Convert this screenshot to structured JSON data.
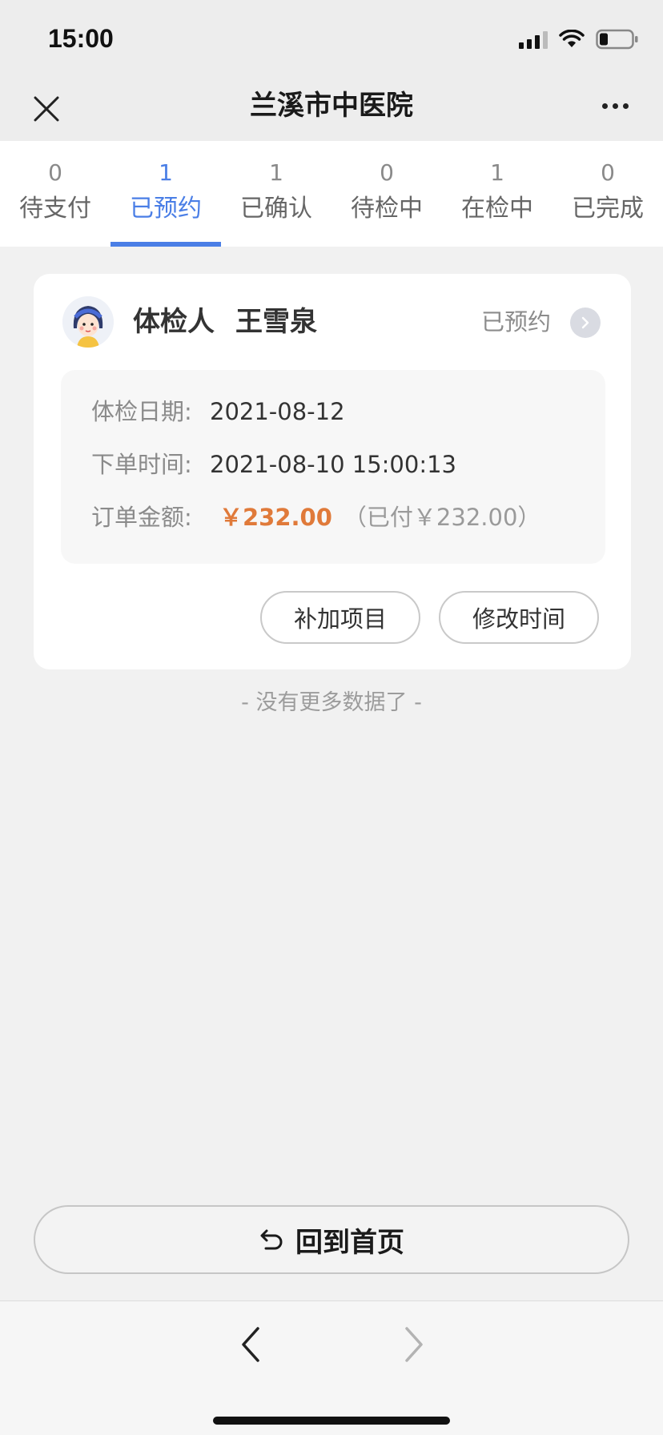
{
  "status_bar": {
    "time": "15:00"
  },
  "nav": {
    "title": "兰溪市中医院"
  },
  "tabs": [
    {
      "count": "0",
      "label": "待支付",
      "active": false
    },
    {
      "count": "1",
      "label": "已预约",
      "active": true
    },
    {
      "count": "1",
      "label": "已确认",
      "active": false
    },
    {
      "count": "0",
      "label": "待检中",
      "active": false
    },
    {
      "count": "1",
      "label": "在检中",
      "active": false
    },
    {
      "count": "0",
      "label": "已完成",
      "active": false
    }
  ],
  "card": {
    "person_label": "体检人",
    "person_name": "王雪泉",
    "status": "已预约",
    "exam_date_label": "体检日期:",
    "exam_date": "2021-08-12",
    "order_time_label": "下单时间:",
    "order_time": "2021-08-10 15:00:13",
    "amount_label": "订单金额:",
    "amount": "￥232.00",
    "paid": "（已付￥232.00）",
    "add_items_button": "补加项目",
    "change_time_button": "修改时间"
  },
  "no_more_text": "- 没有更多数据了 -",
  "home_button": "回到首页",
  "colors": {
    "accent": "#4a7ee6",
    "price": "#e07a3a"
  }
}
